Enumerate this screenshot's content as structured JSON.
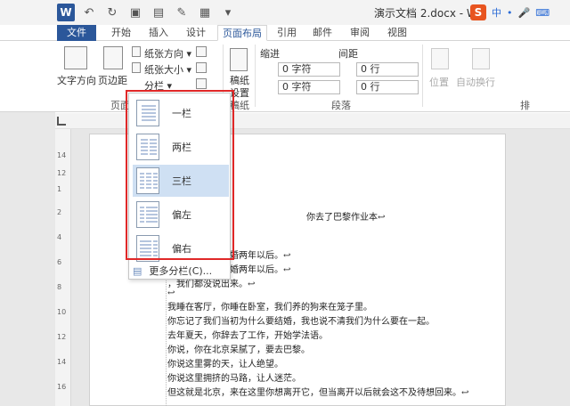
{
  "titlebar": {
    "doc_title": "演示文档 2.docx - Wo",
    "ime_chars": [
      "中",
      "•",
      "🎤",
      "⌨"
    ]
  },
  "tabs": {
    "file": "文件",
    "home": "开始",
    "insert": "插入",
    "design": "设计",
    "layout": "页面布局",
    "references": "引用",
    "mailings": "邮件",
    "review": "审阅",
    "view": "视图"
  },
  "ribbon": {
    "text_direction": "文字方向",
    "margins": "页边距",
    "orientation": "纸张方向 ▾",
    "size": "纸张大小 ▾",
    "columns": "分栏 ▾",
    "page_setup_group": "页面",
    "manuscript": "稿纸",
    "manuscript_setup": "设置",
    "manuscript_group": "稿纸",
    "indent": "缩进",
    "spacing": "间距",
    "indent_left": "0 字符",
    "indent_right": "0 字符",
    "spacing_before": "0 行",
    "spacing_after": "0 行",
    "paragraph_group": "段落",
    "position": "位置",
    "wrap": "自动换行",
    "arrange_group": "排"
  },
  "columns_menu": {
    "items": [
      {
        "label": "一栏",
        "selected": false
      },
      {
        "label": "两栏",
        "selected": false
      },
      {
        "label": "三栏",
        "selected": true
      },
      {
        "label": "偏左",
        "selected": false
      },
      {
        "label": "偏右",
        "selected": false
      }
    ],
    "more": "更多分栏(C)..."
  },
  "document": {
    "heading": "你去了巴黎作业本↩",
    "lines": [
      "          你了，在我们结婚两年以后。↩",
      "          我了，在我们结婚两年以后。↩",
      "          ，我们都没说出来。↩",
      "↩",
      "我睡在客厅，你睡在卧室，我们养的狗来在笼子里。",
      "你忘记了我们当初为什么要结婚，我也说不清我们为什么要在一起。",
      "去年夏天，你辞去了工作，开始学法语。",
      "你说，你在北京呆腻了，要去巴黎。",
      "你说这里雾的天，让人绝望。",
      "你说这里拥挤的马路，让人迷茫。",
      "但这就是北京，来在这里你想离开它，但当离开以后就会这不及待想回来。↩"
    ]
  },
  "ruler": {
    "vertical_numbers": [
      "14",
      "12",
      "1",
      "2",
      "4",
      "6",
      "8",
      "10",
      "12",
      "14",
      "16"
    ]
  }
}
